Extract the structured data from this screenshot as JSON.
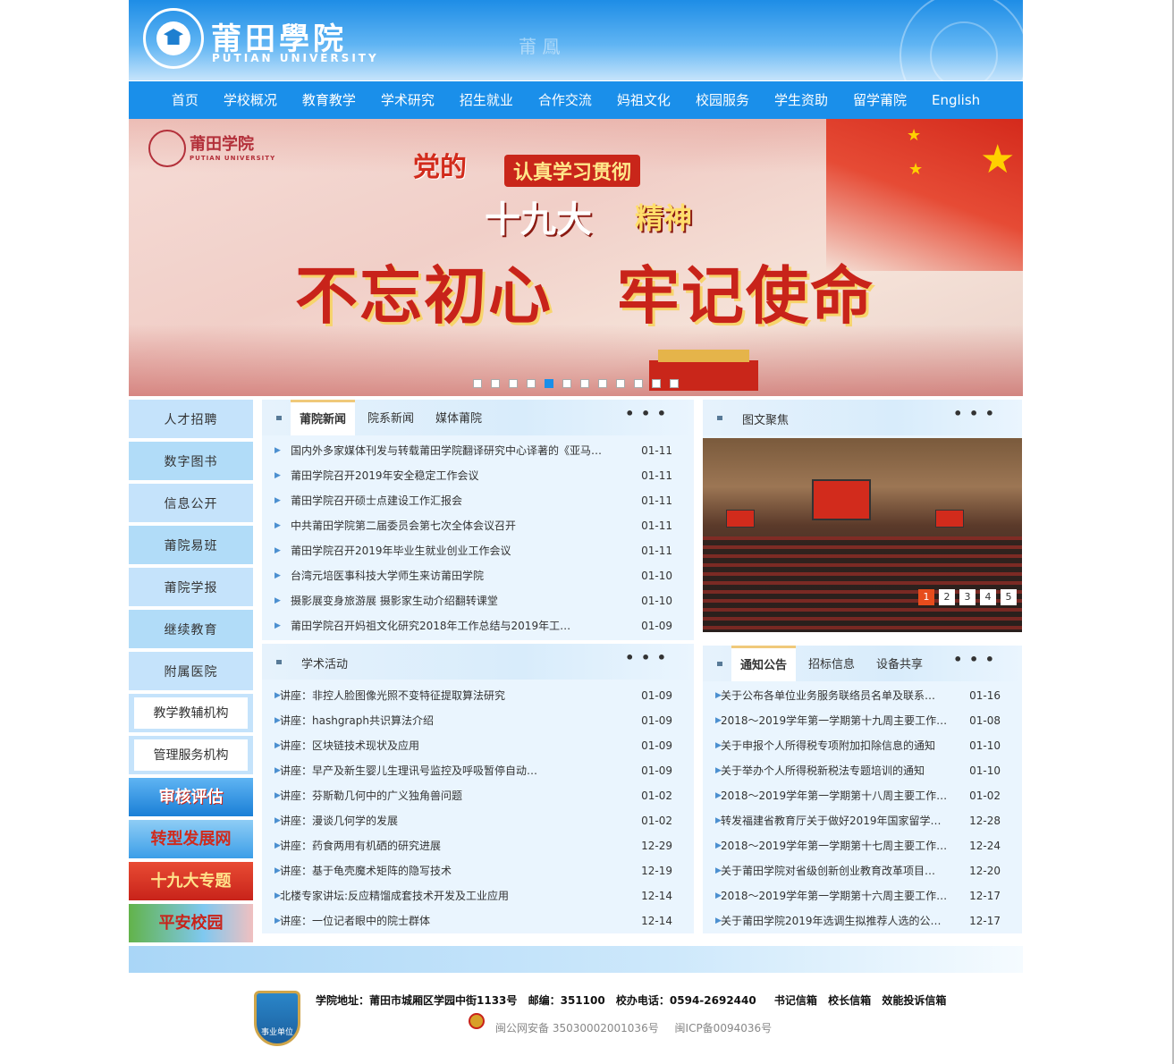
{
  "header": {
    "logo_cn": "莆田學院",
    "logo_en": "PUTIAN UNIVERSITY",
    "deco": "莆 鳳"
  },
  "nav": [
    "首页",
    "学校概况",
    "教育教学",
    "学术研究",
    "招生就业",
    "合作交流",
    "妈祖文化",
    "校园服务",
    "学生资助",
    "留学莆院",
    "English"
  ],
  "banner": {
    "logo_cn": "莆田学院",
    "logo_en": "PUTIAN UNIVERSITY",
    "dang": "党的",
    "ribbon": "认真学习贯彻",
    "nineteen": "十九大",
    "spirit": "精神",
    "slogan": "不忘初心　牢记使命",
    "active_slide": 5,
    "slide_count": 12
  },
  "sidebar": {
    "items": [
      "人才招聘",
      "数字图书",
      "信息公开",
      "莆院易班",
      "莆院学报",
      "继续教育",
      "附属医院"
    ],
    "boxes": [
      "教学教辅机构",
      "管理服务机构"
    ],
    "banners": [
      "审核评估",
      "转型发展网",
      "十九大专题",
      "平安校园"
    ]
  },
  "news": {
    "tabs": [
      "莆院新闻",
      "院系新闻",
      "媒体莆院"
    ],
    "more": "• • •",
    "items": [
      {
        "title": "国内外多家媒体刊发与转载莆田学院翻译研究中心译著的《亚马…",
        "date": "01-11"
      },
      {
        "title": "莆田学院召开2019年安全稳定工作会议",
        "date": "01-11"
      },
      {
        "title": "莆田学院召开硕士点建设工作汇报会",
        "date": "01-11"
      },
      {
        "title": "中共莆田学院第二届委员会第七次全体会议召开",
        "date": "01-11"
      },
      {
        "title": "莆田学院召开2019年毕业生就业创业工作会议",
        "date": "01-11"
      },
      {
        "title": "台湾元培医事科技大学师生来访莆田学院",
        "date": "01-10"
      },
      {
        "title": "摄影展变身旅游展  摄影家生动介绍翻转课堂",
        "date": "01-10"
      },
      {
        "title": "莆田学院召开妈祖文化研究2018年工作总结与2019年工…",
        "date": "01-09"
      }
    ]
  },
  "photo_panel": {
    "title": "图文聚焦",
    "more": "• • •",
    "pages": [
      "1",
      "2",
      "3",
      "4",
      "5"
    ]
  },
  "academic": {
    "title": "学术活动",
    "more": "• • •",
    "items": [
      {
        "title": "讲座：非控人脸图像光照不变特征提取算法研究",
        "date": "01-09"
      },
      {
        "title": "讲座：hashgraph共识算法介绍",
        "date": "01-09"
      },
      {
        "title": "讲座：区块链技术现状及应用",
        "date": "01-09"
      },
      {
        "title": "讲座：早产及新生婴儿生理讯号监控及呼吸暂停自动…",
        "date": "01-09"
      },
      {
        "title": "讲座：芬斯勒几何中的广义独角兽问题",
        "date": "01-02"
      },
      {
        "title": "讲座：漫谈几何学的发展",
        "date": "01-02"
      },
      {
        "title": "讲座：药食两用有机硒的研究进展",
        "date": "12-29"
      },
      {
        "title": "讲座：基于龟壳魔术矩阵的隐写技术",
        "date": "12-19"
      },
      {
        "title": "北楼专家讲坛:反应精馏成套技术开发及工业应用",
        "date": "12-14"
      },
      {
        "title": "讲座：一位记者眼中的院士群体",
        "date": "12-14"
      }
    ]
  },
  "notices": {
    "tabs": [
      "通知公告",
      "招标信息",
      "设备共享"
    ],
    "more": "• • •",
    "items": [
      {
        "title": "关于公布各单位业务服务联络员名单及联系…",
        "date": "01-16"
      },
      {
        "title": "2018～2019学年第一学期第十九周主要工作…",
        "date": "01-08"
      },
      {
        "title": "关于申报个人所得税专项附加扣除信息的通知",
        "date": "01-10"
      },
      {
        "title": "关于举办个人所得税新税法专题培训的通知",
        "date": "01-10"
      },
      {
        "title": "2018～2019学年第一学期第十八周主要工作…",
        "date": "01-02"
      },
      {
        "title": "转发福建省教育厅关于做好2019年国家留学…",
        "date": "12-28"
      },
      {
        "title": "2018～2019学年第一学期第十七周主要工作…",
        "date": "12-24"
      },
      {
        "title": "关于莆田学院对省级创新创业教育改革项目…",
        "date": "12-20"
      },
      {
        "title": "2018～2019学年第一学期第十六周主要工作…",
        "date": "12-17"
      },
      {
        "title": "关于莆田学院2019年选调生拟推荐人选的公…",
        "date": "12-17"
      }
    ]
  },
  "footer": {
    "badge": "事业单位",
    "address": "学院地址：莆田市城厢区学园中街1133号",
    "postcode": "邮编：351100",
    "phone": "校办电话：0594-2692440",
    "links": [
      "书记信箱",
      "校长信箱",
      "效能投诉信箱"
    ],
    "police": "闽公网安备 35030002001036号",
    "icp": "闽ICP备0094036号"
  }
}
